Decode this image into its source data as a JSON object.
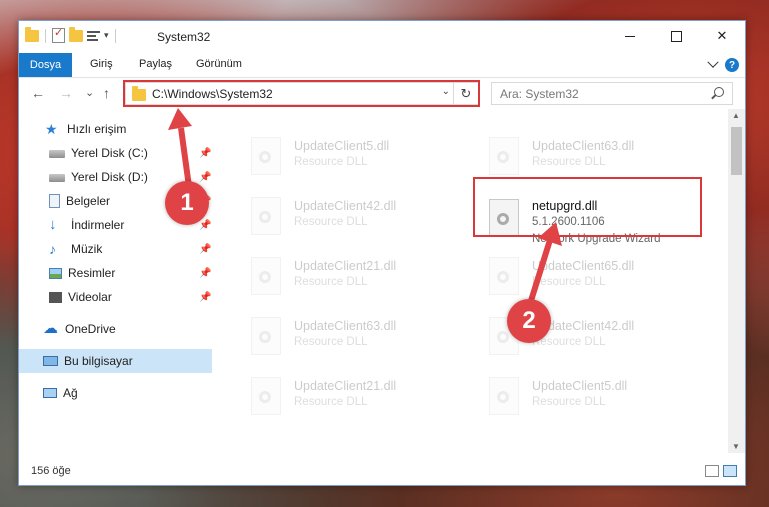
{
  "window": {
    "title": "System32",
    "controls": {
      "minimize": "–",
      "maximize": "□",
      "close": "✕"
    }
  },
  "ribbon": {
    "tabs": [
      "Dosya",
      "Giriş",
      "Paylaş",
      "Görünüm"
    ],
    "help": "?"
  },
  "navigation": {
    "back": "←",
    "forward": "→",
    "recent": "⌄",
    "up": "↑",
    "address": "C:\\Windows\\System32",
    "refresh": "↻",
    "search_placeholder": "Ara: System32"
  },
  "sidebar": {
    "items": [
      {
        "label": "Hızlı erişim",
        "icon": "star-icon",
        "pinned": false
      },
      {
        "label": "Yerel Disk (C:)",
        "icon": "drive-icon",
        "pinned": true
      },
      {
        "label": "Yerel Disk (D:)",
        "icon": "drive-icon",
        "pinned": true
      },
      {
        "label": "Belgeler",
        "icon": "documents-icon",
        "pinned": true
      },
      {
        "label": "İndirmeler",
        "icon": "downloads-icon",
        "pinned": true
      },
      {
        "label": "Müzik",
        "icon": "music-icon",
        "pinned": true
      },
      {
        "label": "Resimler",
        "icon": "pictures-icon",
        "pinned": true
      },
      {
        "label": "Videolar",
        "icon": "videos-icon",
        "pinned": true
      },
      {
        "label": "OneDrive",
        "icon": "onedrive-icon",
        "pinned": false
      },
      {
        "label": "Bu bilgisayar",
        "icon": "computer-icon",
        "pinned": false,
        "selected": true
      },
      {
        "label": "Ağ",
        "icon": "network-icon",
        "pinned": false
      }
    ],
    "pin_glyph": "📌"
  },
  "files": {
    "left": [
      {
        "name": "UpdateClient5.dll",
        "type": "Resource DLL"
      },
      {
        "name": "UpdateClient42.dll",
        "type": "Resource DLL"
      },
      {
        "name": "UpdateClient21.dll",
        "type": "Resource DLL"
      },
      {
        "name": "UpdateClient63.dll",
        "type": "Resource DLL"
      },
      {
        "name": "UpdateClient21.dll",
        "type": "Resource DLL"
      }
    ],
    "right": [
      {
        "name": "UpdateClient63.dll",
        "type": "Resource DLL"
      },
      {
        "name": "netupgrd.dll",
        "version": "5.1.2600.1106",
        "type": "Network Upgrade Wizard",
        "highlighted": true
      },
      {
        "name": "UpdateClient65.dll",
        "type": "Resource DLL"
      },
      {
        "name": "UpdateClient42.dll",
        "type": "Resource DLL"
      },
      {
        "name": "UpdateClient5.dll",
        "type": "Resource DLL"
      }
    ]
  },
  "status": {
    "item_count": "156 öğe"
  },
  "callouts": [
    "1",
    "2"
  ],
  "colors": {
    "accent": "#1979ca",
    "highlight": "#d9383a",
    "selection": "#cce4f7"
  }
}
